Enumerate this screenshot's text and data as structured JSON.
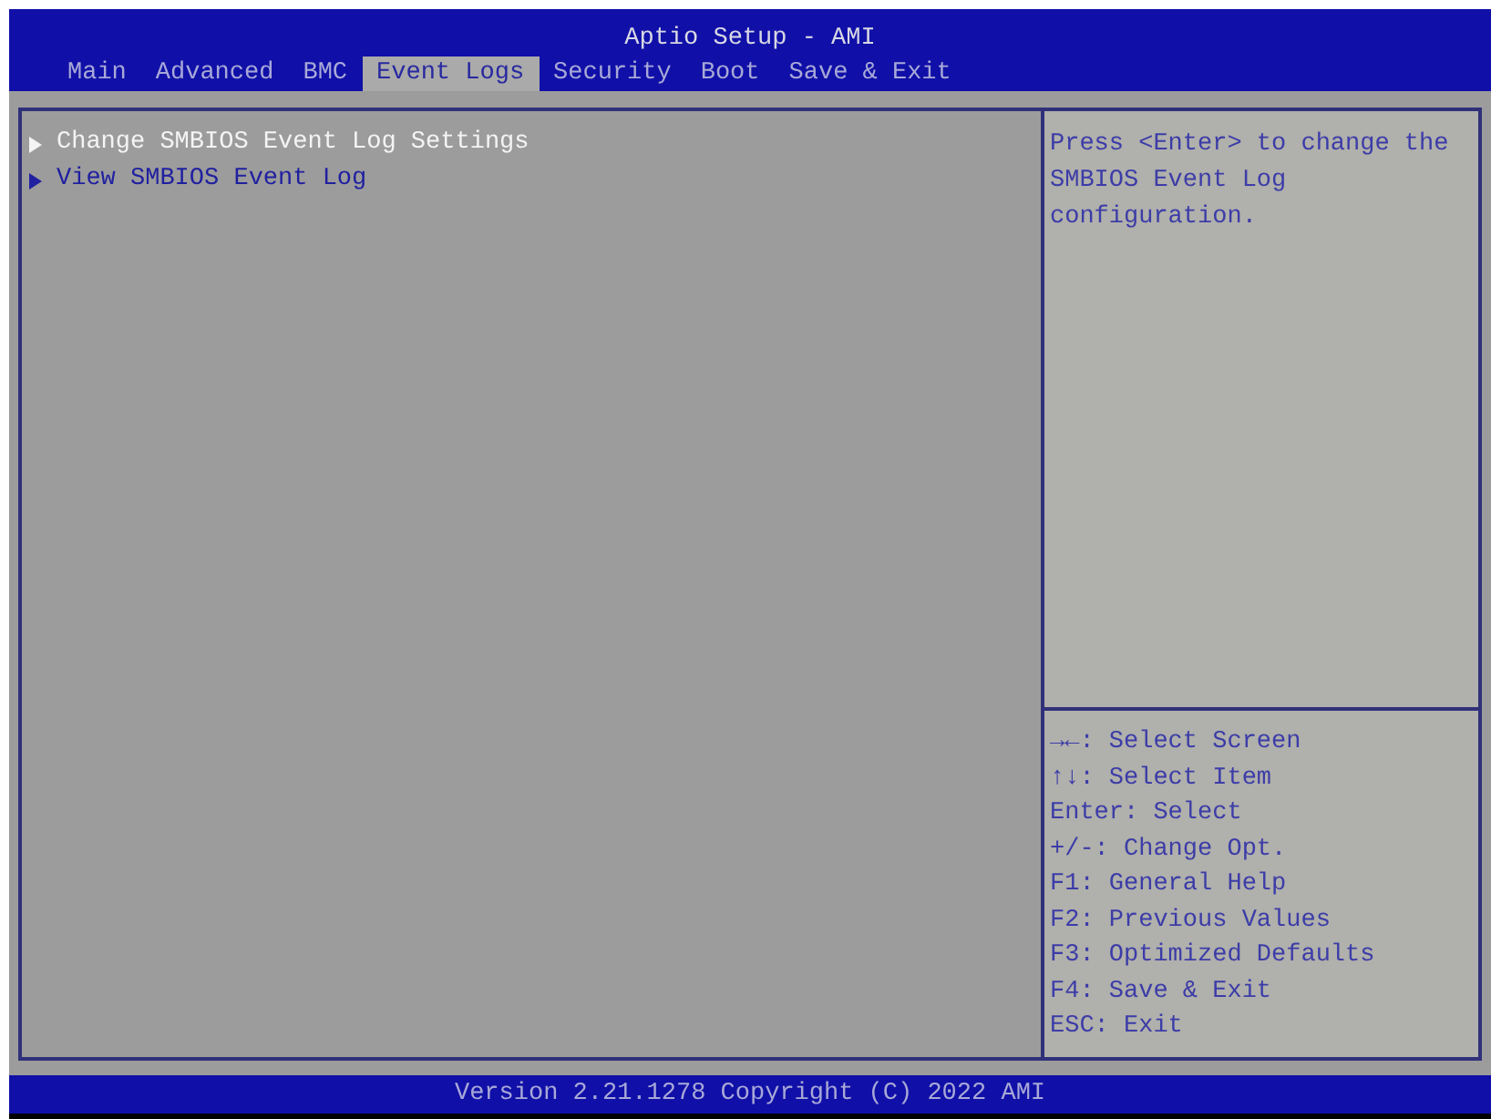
{
  "window": {
    "title": "Aptio Setup - AMI"
  },
  "tabs": [
    {
      "label": "Main",
      "selected": false
    },
    {
      "label": "Advanced",
      "selected": false
    },
    {
      "label": "BMC",
      "selected": false
    },
    {
      "label": "Event Logs",
      "selected": true
    },
    {
      "label": "Security",
      "selected": false
    },
    {
      "label": "Boot",
      "selected": false
    },
    {
      "label": "Save & Exit",
      "selected": false
    }
  ],
  "menu": {
    "items": [
      {
        "label": "Change SMBIOS Event Log Settings",
        "selected": true
      },
      {
        "label": "View SMBIOS Event Log",
        "selected": false
      }
    ]
  },
  "help": {
    "text": "Press <Enter> to change the SMBIOS Event Log configuration."
  },
  "key_legend": [
    "→←: Select Screen",
    "↑↓: Select Item",
    "Enter: Select",
    "+/-: Change Opt.",
    "F1: General Help",
    "F2: Previous Values",
    "F3: Optimized Defaults",
    "F4: Save & Exit",
    "ESC: Exit"
  ],
  "status_bar": {
    "text": "Version 2.21.1278 Copyright (C) 2022 AMI"
  }
}
